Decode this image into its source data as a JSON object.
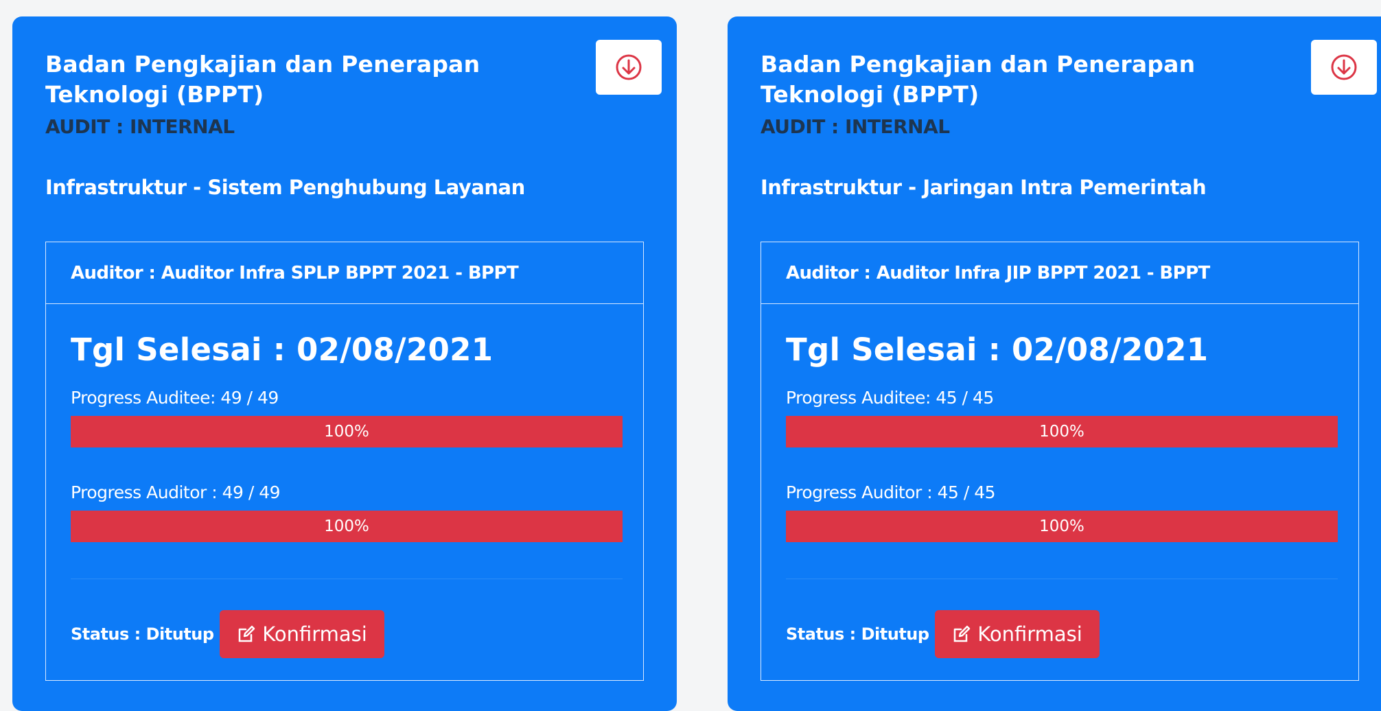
{
  "colors": {
    "card_bg": "#0d7bf7",
    "progress_fill": "#dc3545",
    "button_red": "#dc3545",
    "page_bg": "#f4f5f6"
  },
  "cards": [
    {
      "agency": "Badan Pengkajian dan Penerapan Teknologi (BPPT)",
      "audit_type": "AUDIT : INTERNAL",
      "service": "Infrastruktur - Sistem Penghubung Layanan",
      "download_icon": "download-circle-icon",
      "auditor": "Auditor : Auditor Infra SPLP BPPT 2021 - BPPT",
      "due_date": "Tgl Selesai : 02/08/2021",
      "auditee_progress_label": "Progress Auditee: 49 / 49",
      "auditee_progress_value": 100,
      "auditee_progress_text": "100%",
      "auditor_progress_label": "Progress Auditor : 49 / 49",
      "auditor_progress_value": 100,
      "auditor_progress_text": "100%",
      "status": "Status : Ditutup",
      "confirm_label": "Konfirmasi",
      "confirm_icon": "edit-icon"
    },
    {
      "agency": "Badan Pengkajian dan Penerapan Teknologi (BPPT)",
      "audit_type": "AUDIT : INTERNAL",
      "service": "Infrastruktur - Jaringan Intra Pemerintah",
      "download_icon": "download-circle-icon",
      "auditor": "Auditor : Auditor Infra JIP BPPT 2021 - BPPT",
      "due_date": "Tgl Selesai : 02/08/2021",
      "auditee_progress_label": "Progress Auditee: 45 / 45",
      "auditee_progress_value": 100,
      "auditee_progress_text": "100%",
      "auditor_progress_label": "Progress Auditor : 45 / 45",
      "auditor_progress_value": 100,
      "auditor_progress_text": "100%",
      "status": "Status : Ditutup",
      "confirm_label": "Konfirmasi",
      "confirm_icon": "edit-icon"
    }
  ]
}
